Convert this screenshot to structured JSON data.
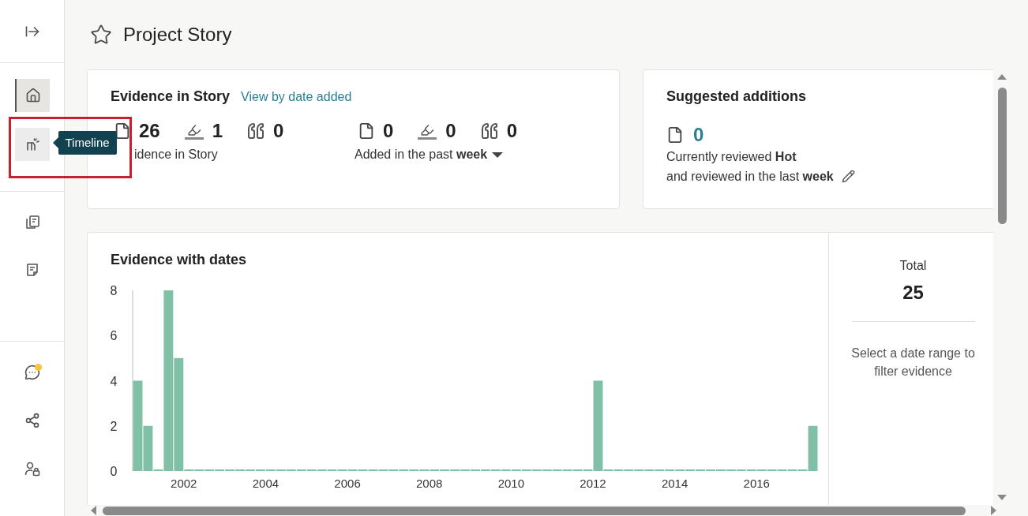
{
  "sidebar": {
    "groups": [
      [
        {
          "selected": false
        }
      ],
      [
        {
          "selected": true
        },
        {
          "selected": false,
          "tooltip": "Timeline"
        }
      ],
      [
        {
          "selected": false
        },
        {
          "selected": false
        }
      ],
      [
        {
          "selected": false,
          "notification": true
        },
        {
          "selected": false,
          "notification": false
        },
        {
          "selected": false,
          "notification": false
        }
      ]
    ]
  },
  "page": {
    "title": "Project Story"
  },
  "evidence_card": {
    "title": "Evidence in Story",
    "link": "View by date added",
    "groups": [
      {
        "counts": [
          "26",
          "1",
          "0"
        ],
        "label": "idence in Story",
        "dropdown": false
      },
      {
        "counts": [
          "0",
          "0",
          "0"
        ],
        "label": "Added in the past **week**",
        "dropdown": true
      }
    ]
  },
  "suggested_card": {
    "title": "Suggested additions",
    "count": "0",
    "lines": [
      "Currently reviewed **Hot**",
      "and reviewed in the last **week**"
    ]
  },
  "dates_card": {
    "title": "Evidence with dates",
    "chart_data": {
      "type": "bar",
      "x": [
        2000.875,
        2001.125,
        2001.375,
        2001.625,
        2001.875,
        2002.125,
        2002.375,
        2002.625,
        2002.875,
        2003.125,
        2003.375,
        2003.625,
        2003.875,
        2004.125,
        2004.375,
        2004.625,
        2004.875,
        2005.125,
        2005.375,
        2005.625,
        2005.875,
        2006.125,
        2006.375,
        2006.625,
        2006.875,
        2007.125,
        2007.375,
        2007.625,
        2007.875,
        2008.125,
        2008.375,
        2008.625,
        2008.875,
        2009.125,
        2009.375,
        2009.625,
        2009.875,
        2010.125,
        2010.375,
        2010.625,
        2010.875,
        2011.125,
        2011.375,
        2011.625,
        2011.875,
        2012.125,
        2012.375,
        2012.625,
        2012.875,
        2013.125,
        2013.375,
        2013.625,
        2013.875,
        2014.125,
        2014.375,
        2014.625,
        2014.875,
        2015.125,
        2015.375,
        2015.625,
        2015.875,
        2016.125,
        2016.375,
        2016.625,
        2016.875,
        2017.125,
        2017.375
      ],
      "series": [
        {
          "color": "#80c0a6",
          "values": [
            4,
            2,
            0,
            8,
            5,
            0,
            0,
            0,
            0,
            0,
            0,
            0,
            0,
            0,
            0,
            0,
            0,
            0,
            0,
            0,
            0,
            0,
            0,
            0,
            0,
            0,
            0,
            0,
            0,
            0,
            0,
            0,
            0,
            0,
            0,
            0,
            0,
            0,
            0,
            0,
            0,
            0,
            0,
            0,
            0,
            4,
            0,
            0,
            0,
            0,
            0,
            0,
            0,
            0,
            0,
            0,
            0,
            0,
            0,
            0,
            0,
            0,
            0,
            0,
            0,
            0,
            2
          ]
        }
      ],
      "xlim": [
        2000.75,
        2017.5
      ],
      "ylim": [
        0,
        8
      ],
      "yticks": [
        0,
        2,
        4,
        6,
        8
      ],
      "xticks": [
        2002,
        2004,
        2006,
        2008,
        2010,
        2012,
        2014,
        2016
      ]
    },
    "summary": {
      "label": "Total",
      "value": "25",
      "hint": "Select a date range to filter evidence"
    }
  }
}
